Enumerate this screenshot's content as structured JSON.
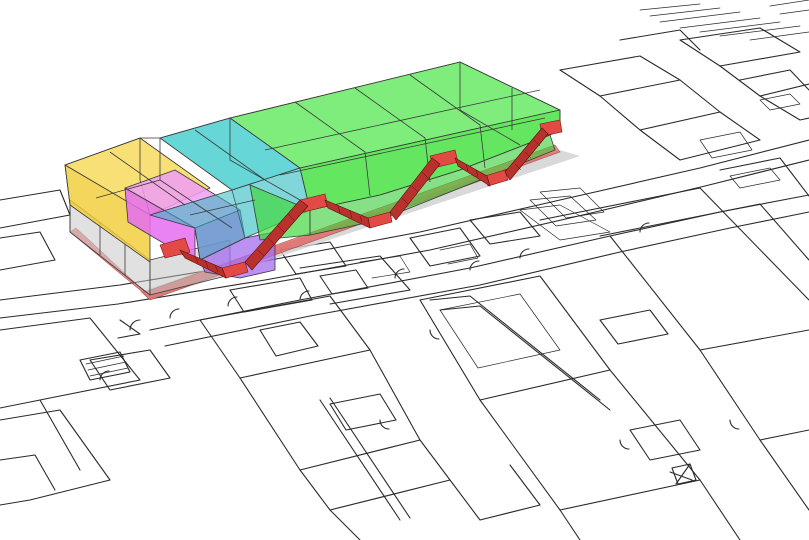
{
  "scene": {
    "kind": "3d-massing-over-floor-plan",
    "background_color": "#ffffff",
    "plan_line_color": "#2a2a2a",
    "volumes": [
      {
        "name": "yellow-block",
        "color": "#f5d54a"
      },
      {
        "name": "cyan-block",
        "color": "#33c8c8"
      },
      {
        "name": "green-block",
        "color": "#3fe03a"
      },
      {
        "name": "magenta-block",
        "color": "#e56cf0"
      },
      {
        "name": "purple-block",
        "color": "#a56cf0"
      },
      {
        "name": "gray-base",
        "color": "#c8c8c8"
      }
    ],
    "stair_color": "#b9312d",
    "landing_color": "#e24a45"
  }
}
